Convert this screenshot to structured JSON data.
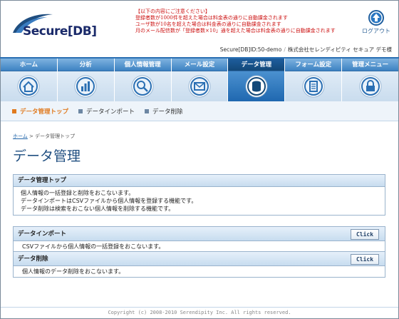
{
  "header": {
    "logo_text": "Secure[DB]",
    "notice": [
      "【以下の内容にご注意ください】",
      "登録者数が1000件を超えた場合は料金表の通りに自動課金されます",
      "ユーザ数が10名を超えた場合は料金表の通りに自動課金されます",
      "月のメール配信数が「登録者数×10」通を超えた場合は料金表の通りに自動課金されます"
    ],
    "logout_label": "ログアウト",
    "account_id": "Secure[DB]ID:50-demo",
    "account_company": "株式会社セレンディピティ セキュア デモ様"
  },
  "nav": {
    "items": [
      {
        "label": "ホーム",
        "icon": "home-icon"
      },
      {
        "label": "分析",
        "icon": "chart-icon"
      },
      {
        "label": "個人情報管理",
        "icon": "search-icon"
      },
      {
        "label": "メール設定",
        "icon": "mail-icon"
      },
      {
        "label": "データ管理",
        "icon": "database-icon",
        "active": true
      },
      {
        "label": "フォーム設定",
        "icon": "form-icon"
      },
      {
        "label": "管理メニュー",
        "icon": "lock-icon"
      }
    ]
  },
  "subnav": {
    "items": [
      {
        "label": "データ管理トップ",
        "active": true
      },
      {
        "label": "データインポート",
        "active": false
      },
      {
        "label": "データ削除",
        "active": false
      }
    ]
  },
  "breadcrumb": {
    "home": "ホーム",
    "separator": ">",
    "current": "データ管理トップ"
  },
  "page_title": "データ管理",
  "overview": {
    "title": "データ管理トップ",
    "lines": [
      "個人情報の一括登録と削除をおこないます。",
      "データインポートはCSVファイルから個人情報を登録する機能です。",
      "データ削除は検索をおこない個人情報を削除する機能です。"
    ]
  },
  "actions": {
    "items": [
      {
        "title": "データインポート",
        "button": "Click",
        "desc": "CSVファイルから個人情報の一括登録をおこないます。"
      },
      {
        "title": "データ削除",
        "button": "Click",
        "desc": "個人情報のデータ削除をおこないます。"
      }
    ]
  },
  "footer": {
    "copyright": "Copyright (c) 2008-2010 Serendipity  Inc. All rights reserved."
  },
  "colors": {
    "accent": "#1f4e80",
    "active_orange": "#e07a1f",
    "notice_red": "#cc1111"
  }
}
